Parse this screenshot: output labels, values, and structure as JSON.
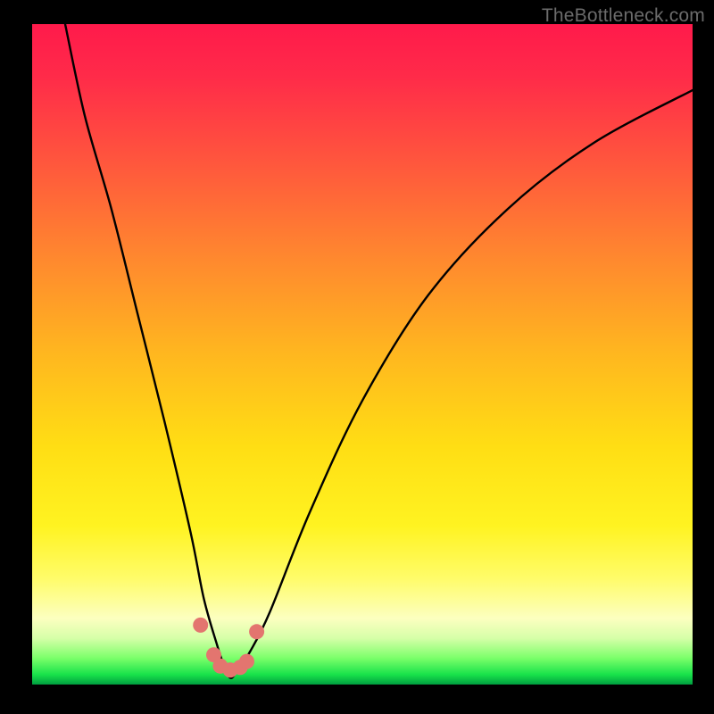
{
  "watermark": "TheBottleneck.com",
  "chart_data": {
    "type": "line",
    "title": "",
    "xlabel": "",
    "ylabel": "",
    "xlim": [
      0,
      100
    ],
    "ylim": [
      0,
      100
    ],
    "grid": false,
    "series": [
      {
        "name": "bottleneck-curve",
        "x": [
          5,
          8,
          12,
          16,
          20,
          24,
          26,
          28,
          29,
          30,
          31,
          33,
          36,
          42,
          50,
          60,
          72,
          85,
          100
        ],
        "values": [
          100,
          86,
          72,
          56,
          40,
          23,
          13,
          6,
          3,
          1,
          2,
          5,
          11,
          26,
          43,
          59,
          72,
          82,
          90
        ]
      }
    ],
    "markers": {
      "name": "highlight-points",
      "x": [
        25.5,
        27.5,
        28.5,
        30.0,
        31.5,
        32.5,
        34.0
      ],
      "values": [
        9.0,
        4.5,
        2.8,
        2.2,
        2.6,
        3.5,
        8.0
      ]
    },
    "background_gradient": {
      "top": "#ff1a4b",
      "mid": "#ffde14",
      "bottom": "#009e40"
    }
  }
}
